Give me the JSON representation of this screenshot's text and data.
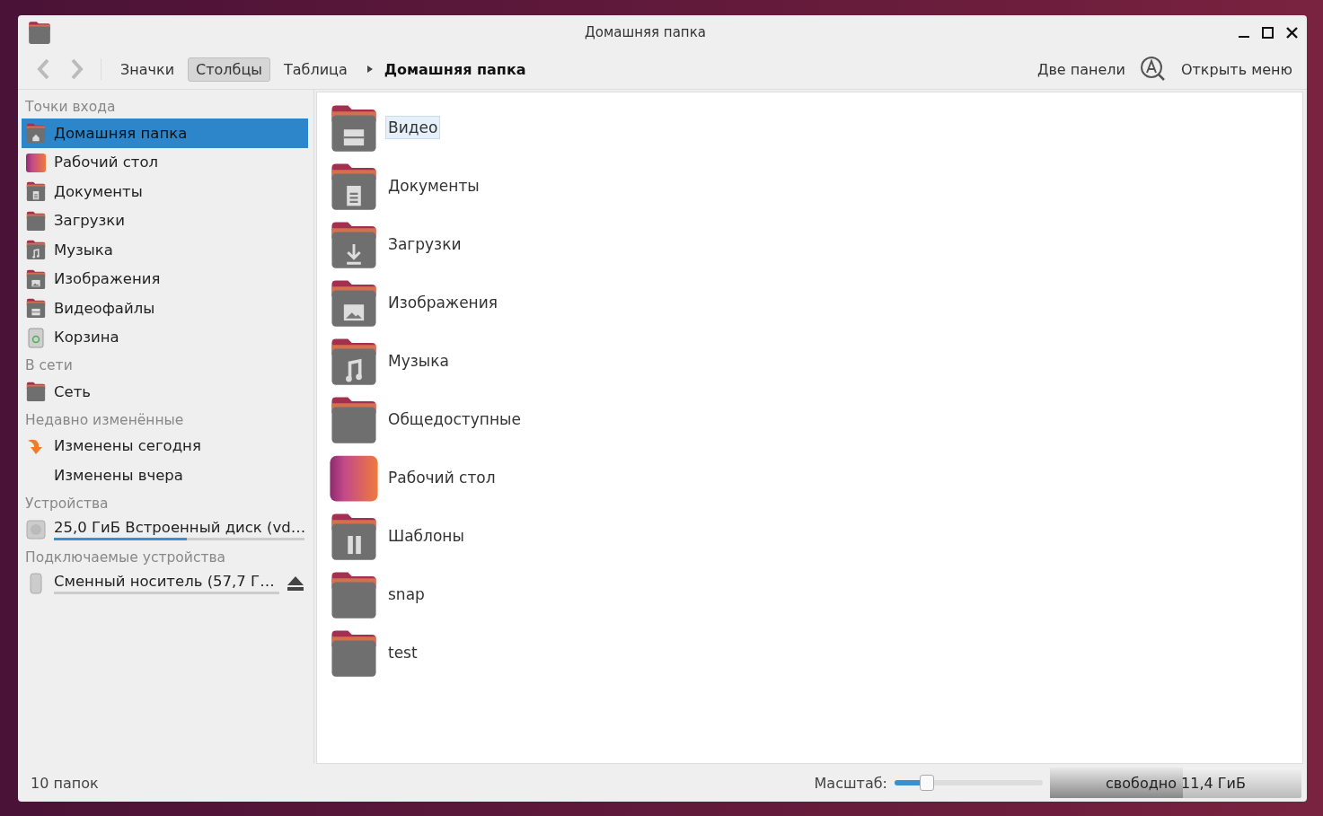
{
  "window": {
    "title": "Домашняя папка"
  },
  "toolbar": {
    "views": [
      {
        "label": "Значки",
        "selected": false
      },
      {
        "label": "Столбцы",
        "selected": true
      },
      {
        "label": "Таблица",
        "selected": false
      }
    ],
    "breadcrumb": "Домашняя папка",
    "dual_pane": "Две панели",
    "menu": "Открыть меню"
  },
  "sidebar": {
    "sections": [
      {
        "title": "Точки входа",
        "items": [
          {
            "kind": "home",
            "label": "Домашняя папка",
            "selected": true
          },
          {
            "kind": "desktop",
            "label": "Рабочий стол",
            "selected": false
          },
          {
            "kind": "document",
            "label": "Документы",
            "selected": false
          },
          {
            "kind": "folder",
            "label": "Загрузки",
            "selected": false
          },
          {
            "kind": "music",
            "label": "Музыка",
            "selected": false
          },
          {
            "kind": "image",
            "label": "Изображения",
            "selected": false
          },
          {
            "kind": "video",
            "label": "Видеофайлы",
            "selected": false
          },
          {
            "kind": "trash",
            "label": "Корзина",
            "selected": false
          }
        ]
      },
      {
        "title": "В сети",
        "items": [
          {
            "kind": "folder",
            "label": "Сеть",
            "selected": false
          }
        ]
      },
      {
        "title": "Недавно изменённые",
        "items": [
          {
            "kind": "recent",
            "label": "Изменены сегодня",
            "selected": false
          },
          {
            "kind": "none",
            "label": "Изменены вчера",
            "selected": false
          }
        ]
      },
      {
        "title": "Устройства",
        "items": [
          {
            "kind": "disk",
            "label": "25,0 ГиБ Встроенный диск (vd…",
            "selected": false,
            "level": 0.53
          }
        ]
      },
      {
        "title": "Подключаемые устройства",
        "items": [
          {
            "kind": "usb",
            "label": "Сменный носитель (57,7 Г…",
            "selected": false,
            "eject": true
          }
        ]
      }
    ]
  },
  "files": [
    {
      "kind": "video",
      "name": "Видео",
      "selected": true
    },
    {
      "kind": "document",
      "name": "Документы",
      "selected": false
    },
    {
      "kind": "download",
      "name": "Загрузки",
      "selected": false
    },
    {
      "kind": "image",
      "name": "Изображения",
      "selected": false
    },
    {
      "kind": "music",
      "name": "Музыка",
      "selected": false
    },
    {
      "kind": "folder",
      "name": "Общедоступные",
      "selected": false
    },
    {
      "kind": "desktop",
      "name": "Рабочий стол",
      "selected": false
    },
    {
      "kind": "template",
      "name": "Шаблоны",
      "selected": false
    },
    {
      "kind": "folder",
      "name": "snap",
      "selected": false
    },
    {
      "kind": "folder",
      "name": "test",
      "selected": false
    }
  ],
  "status_bar": {
    "count": "10 папок",
    "zoom_label": "Масштаб:",
    "zoom": {
      "level": 0.21
    },
    "free": {
      "text": "свободно 11,4 ГиБ",
      "level": 0.53
    }
  }
}
